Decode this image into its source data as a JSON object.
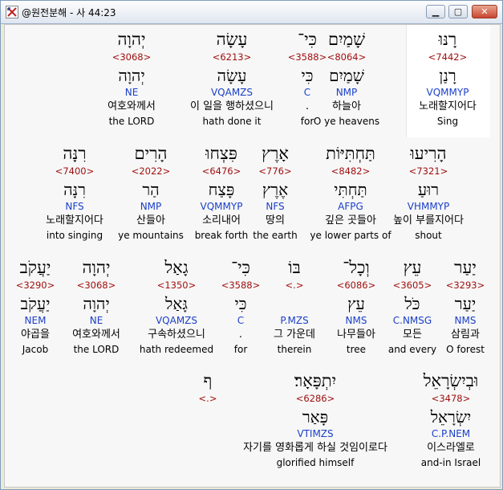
{
  "window": {
    "title": "@원전분해 - 사 44:23",
    "icon": "cross-arrows-icon",
    "controls": {
      "minimize": "▁",
      "maximize": "▢",
      "close": "✕"
    }
  },
  "lines": [
    [
      {
        "heb": "רָנּוּ",
        "num": "<7442>",
        "lemma": "רָנַן",
        "code": "VQMMYP",
        "kor": "노래할지어다",
        "eng": "Sing"
      },
      {
        "heb": "שָׁמַיִם",
        "num": "<8064>",
        "lemma": "שָׁמַיִם",
        "code": "NMP",
        "kor": "하늘아",
        "eng": "O ye heavens"
      },
      {
        "heb": "כִּי־",
        "num": "<3588>",
        "lemma": "כִּי",
        "code": "C",
        "kor": ".",
        "eng": "for"
      },
      {
        "heb": "עָשָׂה",
        "num": "<6213>",
        "lemma": "עָשָׂה",
        "code": "VQAMZS",
        "kor": "이 일을 행하셨으니",
        "eng": "hath done it"
      },
      {
        "heb": "יְהוָה",
        "num": "<3068>",
        "lemma": "יְהוָה",
        "code": "NE",
        "kor": "여호와께서",
        "eng": "the LORD"
      }
    ],
    [
      {
        "heb": "הָרִיעוּ",
        "num": "<7321>",
        "lemma": "רוּעַ",
        "code": "VHMMYP",
        "kor": "높이 부를지어다",
        "eng": "shout"
      },
      {
        "heb": "תַּחְתִּיּוֹת",
        "num": "<8482>",
        "lemma": "תַּחְתִּי",
        "code": "AFPG",
        "kor": "깊은 곳들아",
        "eng": "ye lower parts of"
      },
      {
        "heb": "אָרֶץ",
        "num": "<776>",
        "lemma": "אֶרֶץ",
        "code": "NFS",
        "kor": "땅의",
        "eng": "the earth"
      },
      {
        "heb": "פִּצְחוּ",
        "num": "<6476>",
        "lemma": "פָּצַח",
        "code": "VQMMYP",
        "kor": "소리내어",
        "eng": "break forth"
      },
      {
        "heb": "הָרִים",
        "num": "<2022>",
        "lemma": "הַר",
        "code": "NMP",
        "kor": "산들아",
        "eng": "ye mountains"
      },
      {
        "heb": "רִנָּה",
        "num": "<7400>",
        "lemma": "רִנָּה",
        "code": "NFS",
        "kor": "노래할지어다",
        "eng": "into singing"
      }
    ],
    [
      {
        "heb": "יַעַר",
        "num": "<3293>",
        "lemma": "יַעַר",
        "code": "NMS",
        "kor": "삼림과",
        "eng": "O forest"
      },
      {
        "heb": "עֵץ",
        "num": "<3605>",
        "lemma": "כֹּל",
        "code": "C.NMSG",
        "kor": "모든",
        "eng": "and every"
      },
      {
        "heb": "וְכָל־",
        "num": "<6086>",
        "lemma": "עֵץ",
        "code": "NMS",
        "kor": "나무들아",
        "eng": "tree"
      },
      {
        "heb": "בּוֹ",
        "num": "<.>",
        "lemma": "",
        "code": "P.MZS",
        "kor": "그 가운데",
        "eng": "therein"
      },
      {
        "heb": "כִּי־",
        "num": "<3588>",
        "lemma": "כִּי",
        "code": "C",
        "kor": ".",
        "eng": "for"
      },
      {
        "heb": "גָאַל",
        "num": "<1350>",
        "lemma": "גָּאַל",
        "code": "VQAMZS",
        "kor": "구속하셨으니",
        "eng": "hath redeemed"
      },
      {
        "heb": "יְהוָה",
        "num": "<3068>",
        "lemma": "יְהוָה",
        "code": "NE",
        "kor": "여호와께서",
        "eng": "the LORD"
      },
      {
        "heb": "יַעֲקֹב",
        "num": "<3290>",
        "lemma": "יַעֲקֹב",
        "code": "NEM",
        "kor": "야곱을",
        "eng": "Jacob"
      }
    ],
    [
      {
        "heb": "וּבְיִשְׂרָאֵל",
        "num": "<3478>",
        "lemma": "יִשְׂרָאֵל",
        "code": "C.P.NEM",
        "kor": "이스라엘로",
        "eng": "and-in Israel"
      },
      {
        "heb": "יִתְפָּאָר׃",
        "num": "<6286>",
        "lemma": "פָּאַר",
        "code": "VTIMZS",
        "kor": "자기를 영화롭게 하실 것임이로다",
        "eng": "glorified himself"
      },
      {
        "heb": "ף",
        "num": "<.>",
        "lemma": "",
        "code": "",
        "kor": "",
        "eng": ""
      }
    ]
  ]
}
